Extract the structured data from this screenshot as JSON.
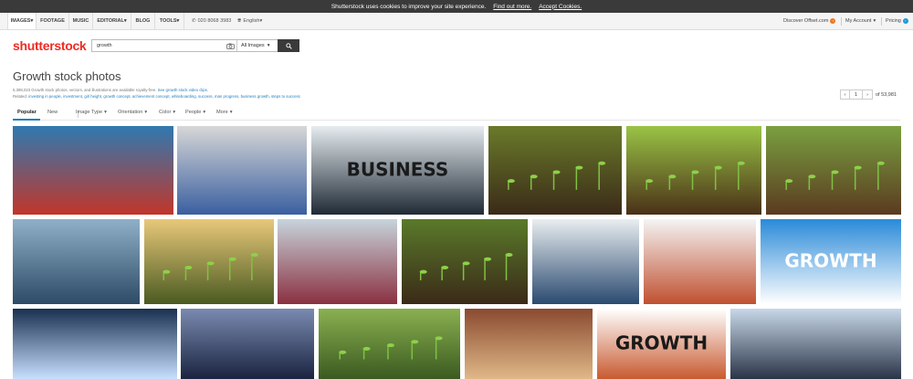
{
  "cookie_bar": {
    "message": "Shutterstock uses cookies to improve your site experience.",
    "find_out_more": "Find out more.",
    "accept": "Accept Cookies."
  },
  "nav": {
    "items": [
      "IMAGES",
      "FOOTAGE",
      "MUSIC",
      "EDITORIAL",
      "BLOG",
      "TOOLS"
    ],
    "phone": "020 8068 3983",
    "language": "English",
    "discover": "Discover Offset.com",
    "account": "My Account",
    "pricing": "Pricing"
  },
  "logo": {
    "text": "shutterstock"
  },
  "search": {
    "query": "growth",
    "filter": "All Images"
  },
  "header": {
    "title": "Growth stock photos",
    "description_prefix": "5,398,023 Growth stock photos, vectors, and illustrations are available royalty-free.",
    "description_link": "See growth stock video clips.",
    "related_label": "Related:",
    "related_terms": "investing in people, investment, girl height, growth concept, achievement concept, whiteboarding, success, man progress, business growth, steps to success"
  },
  "pager": {
    "prev": "‹",
    "page": "1",
    "next": "›",
    "of_label": "of 53,981"
  },
  "filters": {
    "tabs": [
      "Popular",
      "New"
    ],
    "dropdowns": [
      "Image Type",
      "Orientation",
      "Color",
      "People",
      "More"
    ]
  },
  "images": [
    {
      "subject": "red ladder against sky",
      "colors": [
        "#2f79b0",
        "#c2362a"
      ]
    },
    {
      "subject": "girl measuring height on wall",
      "colors": [
        "#d7d7d7",
        "#3a5fa0"
      ]
    },
    {
      "subject": "business sketch whiteboard",
      "colors": [
        "#e6ecef",
        "#1f2a36"
      ],
      "text": "BUSINESS"
    },
    {
      "subject": "seedling in soil",
      "colors": [
        "#6a7a2a",
        "#3a2a18"
      ]
    },
    {
      "subject": "sprouts in a row",
      "colors": [
        "#9ac445",
        "#4a3018"
      ]
    },
    {
      "subject": "hand planting seedlings",
      "colors": [
        "#7aa040",
        "#5a3a20"
      ]
    },
    {
      "subject": "businessman drawing graph",
      "colors": [
        "#8fb0c8",
        "#2d4a66"
      ]
    },
    {
      "subject": "sprout in sunlight",
      "colors": [
        "#e8c87a",
        "#4a5a20"
      ]
    },
    {
      "subject": "calculator and finance papers",
      "colors": [
        "#c7d4dc",
        "#8a3040"
      ]
    },
    {
      "subject": "growing plants sequence",
      "colors": [
        "#5a7a2a",
        "#3a2a18"
      ]
    },
    {
      "subject": "desk with charts and coffee",
      "colors": [
        "#e9eef0",
        "#2a4a70"
      ]
    },
    {
      "subject": "crowd forming arrow",
      "colors": [
        "#f4f4f4",
        "#c05030"
      ]
    },
    {
      "subject": "GROWTH graphic blue",
      "colors": [
        "#2a8ad8",
        "#ffffff"
      ],
      "text": "GROWTH"
    },
    {
      "subject": "businessman glowing graph",
      "colors": [
        "#1a3050",
        "#c8e0ff"
      ]
    },
    {
      "subject": "city finance chart",
      "colors": [
        "#7a8ab0",
        "#1a2440"
      ]
    },
    {
      "subject": "blurred green plants",
      "colors": [
        "#8ab050",
        "#3a5a20"
      ]
    },
    {
      "subject": "wooden figure climbing blocks",
      "colors": [
        "#8a4a30",
        "#e0b888"
      ]
    },
    {
      "subject": "stairs and arrow GROWTH",
      "colors": [
        "#ffffff",
        "#c85a30"
      ],
      "text": "GROWTH"
    },
    {
      "subject": "businessman city skyline",
      "colors": [
        "#c8d8e8",
        "#2a3448"
      ]
    }
  ]
}
